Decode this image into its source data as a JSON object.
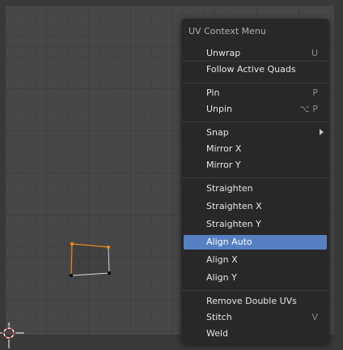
{
  "menu": {
    "title": "UV Context Menu",
    "items": [
      {
        "label": "Unwrap",
        "shortcut": "U"
      },
      {
        "label": "Follow Active Quads",
        "shortcut": ""
      },
      {
        "label": "Pin",
        "shortcut": "P"
      },
      {
        "label": "Unpin",
        "shortcut": "⌥ P"
      },
      {
        "label": "Snap",
        "shortcut": "",
        "submenu": true
      },
      {
        "label": "Mirror X",
        "shortcut": ""
      },
      {
        "label": "Mirror Y",
        "shortcut": ""
      },
      {
        "label": "Straighten",
        "shortcut": ""
      },
      {
        "label": "Straighten X",
        "shortcut": ""
      },
      {
        "label": "Straighten Y",
        "shortcut": ""
      },
      {
        "label": "Align Auto",
        "shortcut": "",
        "active": true
      },
      {
        "label": "Align X",
        "shortcut": ""
      },
      {
        "label": "Align Y",
        "shortcut": ""
      },
      {
        "label": "Remove Double UVs",
        "shortcut": ""
      },
      {
        "label": "Stitch",
        "shortcut": "V"
      },
      {
        "label": "Weld",
        "shortcut": ""
      }
    ]
  },
  "colors": {
    "viewport_bg": "#474747",
    "menu_bg": "#282828",
    "highlight": "#5680c2",
    "selected_edge": "#e8891d",
    "unselected_edge": "#d9d9d9"
  }
}
